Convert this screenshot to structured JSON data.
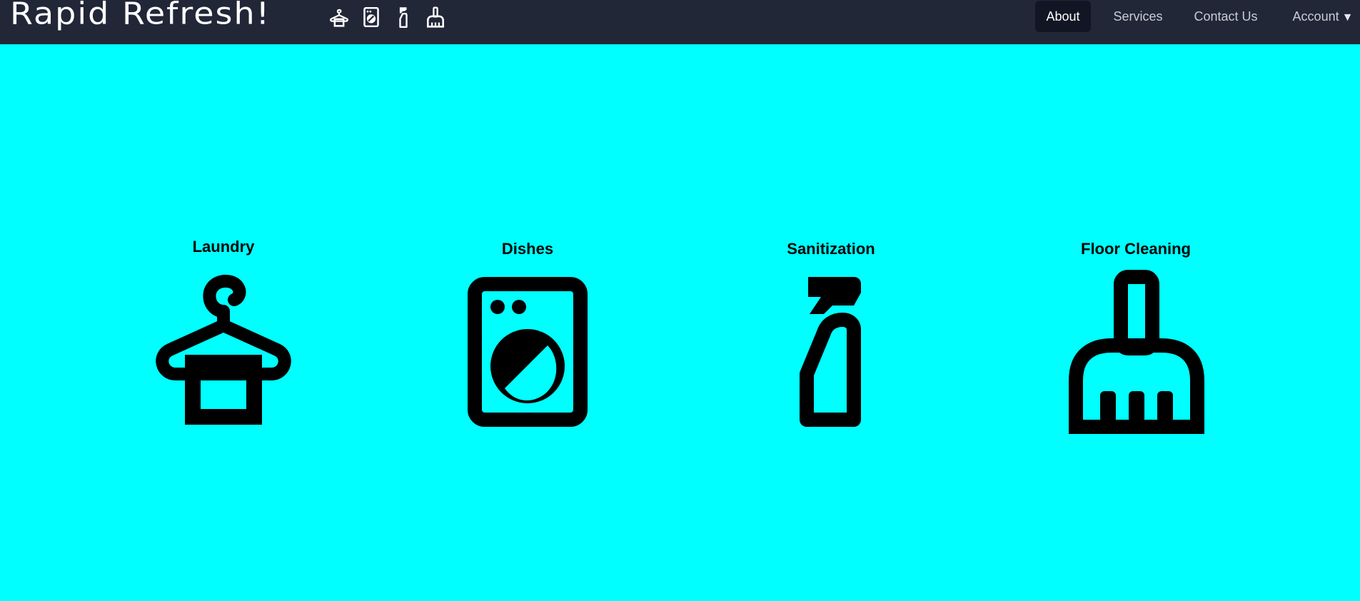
{
  "header": {
    "brand": "Rapid Refresh!",
    "brand_icons": [
      "hanger-icon",
      "washing-machine-icon",
      "spray-bottle-icon",
      "broom-icon"
    ],
    "background": "#212737"
  },
  "nav": {
    "items": [
      {
        "label": "About",
        "active": true
      },
      {
        "label": "Services",
        "active": false
      },
      {
        "label": "Contact Us",
        "active": false
      },
      {
        "label": "Account",
        "active": false,
        "caret": "▼"
      }
    ]
  },
  "main": {
    "background": "#00ffff",
    "services": [
      {
        "title": "Laundry",
        "icon": "hanger-icon"
      },
      {
        "title": "Dishes",
        "icon": "washing-machine-icon"
      },
      {
        "title": "Sanitization",
        "icon": "spray-bottle-icon"
      },
      {
        "title": "Floor Cleaning",
        "icon": "broom-icon"
      }
    ]
  }
}
